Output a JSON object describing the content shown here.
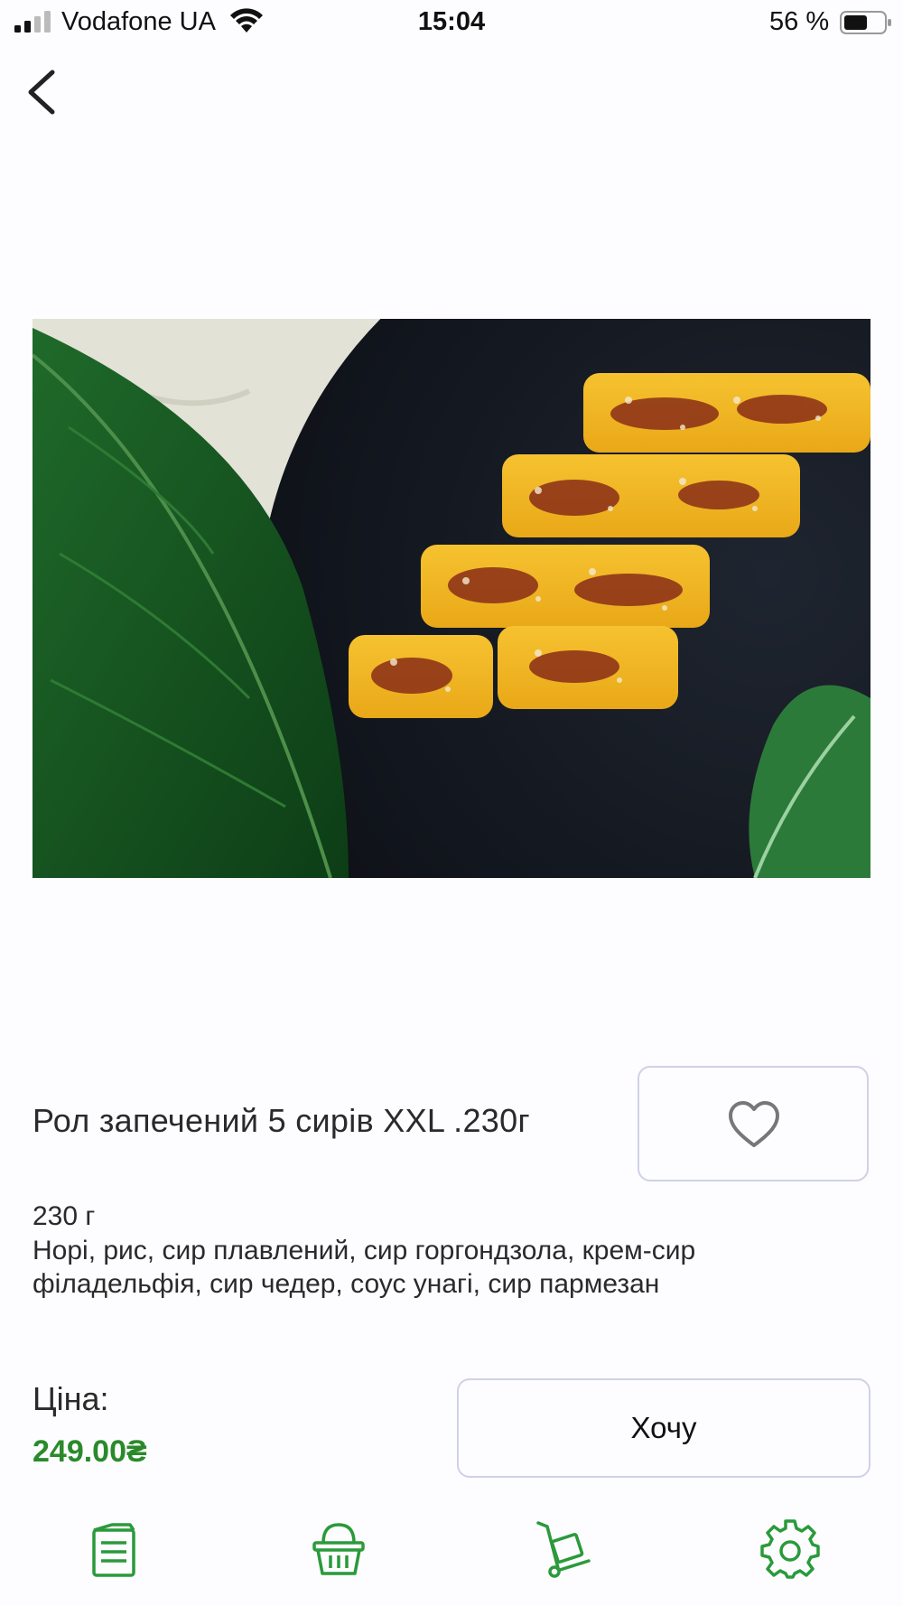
{
  "status_bar": {
    "carrier": "Vodafone UA",
    "time": "15:04",
    "battery": "56 %"
  },
  "product": {
    "title": "Рол запечений 5 сирів XXL .230г",
    "weight": "230 г",
    "ingredients": "Норі, рис, сир плавлений, сир горгондзола,  крем-сир\nфіладельфія, сир чедер, соус унагі, сир пармезан",
    "price_label": "Ціна:",
    "price": "249.00₴",
    "want_label": "Хочу"
  },
  "colors": {
    "accent": "#2a8a2a",
    "border": "#cfd2e6",
    "icon": "#2a9a3a"
  },
  "tab_bar": {
    "items": [
      "menu-icon",
      "basket-icon",
      "delivery-cart-icon",
      "settings-gear-icon"
    ]
  }
}
